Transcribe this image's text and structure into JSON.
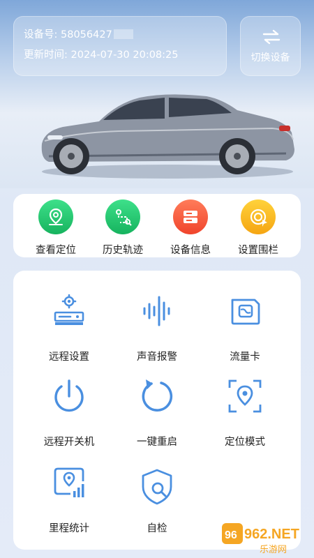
{
  "device": {
    "id_label": "设备号: 58056427",
    "updated_label": "更新时间: 2024-07-30 20:08:25"
  },
  "switch_button": {
    "label": "切换设备",
    "icon": "swap-arrows-icon"
  },
  "quick_actions": [
    {
      "label": "查看定位",
      "icon": "location-pin-icon",
      "color": "#1fc46b"
    },
    {
      "label": "历史轨迹",
      "icon": "route-history-icon",
      "color": "#1fc46b"
    },
    {
      "label": "设备信息",
      "icon": "device-info-icon",
      "color": "#f75a3c"
    },
    {
      "label": "设置围栏",
      "icon": "geofence-icon",
      "color": "#f7b51d"
    }
  ],
  "functions": [
    {
      "label": "远程设置",
      "icon": "remote-settings-icon"
    },
    {
      "label": "声音报警",
      "icon": "sound-alarm-icon"
    },
    {
      "label": "流量卡",
      "icon": "sim-card-icon"
    },
    {
      "label": "远程开关机",
      "icon": "power-icon"
    },
    {
      "label": "一键重启",
      "icon": "restart-icon"
    },
    {
      "label": "定位模式",
      "icon": "location-mode-icon"
    },
    {
      "label": "里程统计",
      "icon": "mileage-stats-icon"
    },
    {
      "label": "自检",
      "icon": "self-check-icon"
    }
  ],
  "watermark": {
    "brand": "962.NET",
    "site": "乐游网"
  },
  "colors": {
    "accent": "#4a8fe0",
    "green": "#1fc46b",
    "orange": "#f75a3c",
    "yellow": "#f7b51d"
  }
}
